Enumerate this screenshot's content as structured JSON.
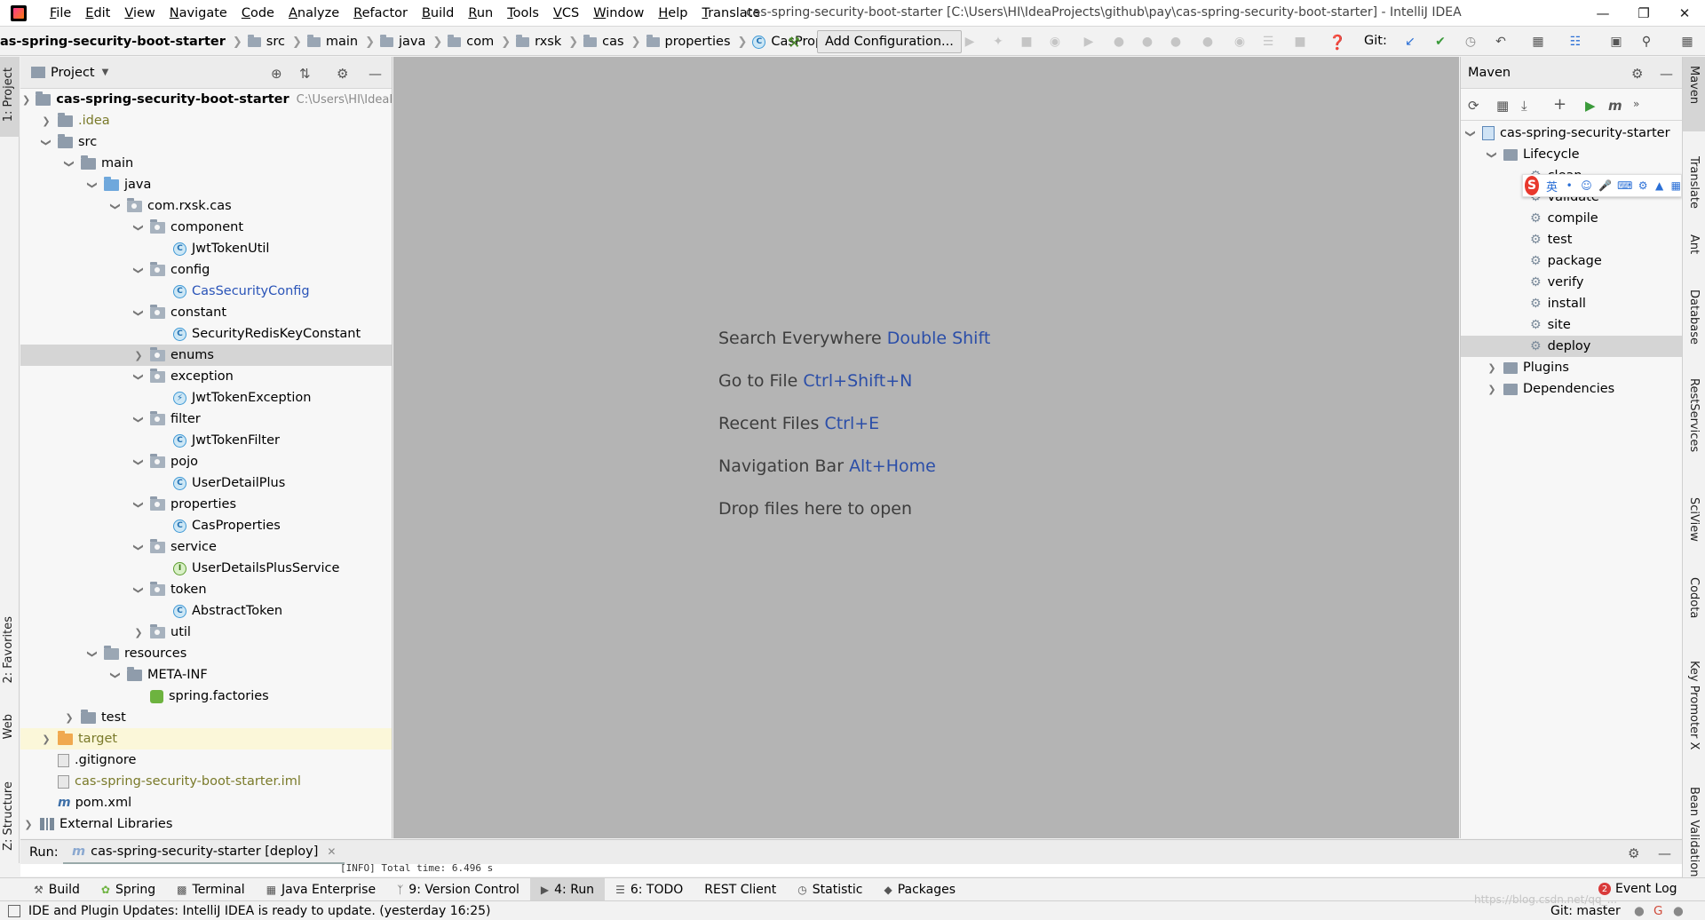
{
  "menu": [
    "File",
    "Edit",
    "View",
    "Navigate",
    "Code",
    "Analyze",
    "Refactor",
    "Build",
    "Run",
    "Tools",
    "VCS",
    "Window",
    "Help",
    "Translate"
  ],
  "window_title": "cas-spring-security-boot-starter [C:\\Users\\HI\\IdeaProjects\\github\\pay\\cas-spring-security-boot-starter] - IntelliJ IDEA",
  "breadcrumb": {
    "root": "as-spring-security-boot-starter",
    "parts": [
      "src",
      "main",
      "java",
      "com",
      "rxsk",
      "cas",
      "properties"
    ],
    "file": "CasProperties"
  },
  "toolbar": {
    "add_config": "Add Configuration...",
    "git_label": "Git:"
  },
  "left_stripe": {
    "project": "1: Project",
    "favorites": "2: Favorites",
    "web": "Web",
    "structure": "Z: Structure"
  },
  "right_stripe": [
    "Maven",
    "Translate",
    "Ant",
    "Database",
    "RestServices",
    "SciView",
    "Codota",
    "Key Promoter X",
    "Bean Validation"
  ],
  "project": {
    "title": "Project",
    "root": {
      "name": "cas-spring-security-boot-starter",
      "path": "C:\\Users\\HI\\IdeaPro"
    },
    "tree": [
      {
        "label": ".idea"
      },
      {
        "label": "src"
      },
      {
        "label": "main"
      },
      {
        "label": "java"
      },
      {
        "label": "com.rxsk.cas"
      },
      {
        "label": "component"
      },
      {
        "label": "JwtTokenUtil"
      },
      {
        "label": "config"
      },
      {
        "label": "CasSecurityConfig"
      },
      {
        "label": "constant"
      },
      {
        "label": "SecurityRedisKeyConstant"
      },
      {
        "label": "enums"
      },
      {
        "label": "exception"
      },
      {
        "label": "JwtTokenException"
      },
      {
        "label": "filter"
      },
      {
        "label": "JwtTokenFilter"
      },
      {
        "label": "pojo"
      },
      {
        "label": "UserDetailPlus"
      },
      {
        "label": "properties"
      },
      {
        "label": "CasProperties"
      },
      {
        "label": "service"
      },
      {
        "label": "UserDetailsPlusService"
      },
      {
        "label": "token"
      },
      {
        "label": "AbstractToken"
      },
      {
        "label": "util"
      },
      {
        "label": "resources"
      },
      {
        "label": "META-INF"
      },
      {
        "label": "spring.factories"
      },
      {
        "label": "test"
      },
      {
        "label": "target"
      },
      {
        "label": ".gitignore"
      },
      {
        "label": "cas-spring-security-boot-starter.iml"
      },
      {
        "label": "pom.xml"
      },
      {
        "label": "External Libraries"
      }
    ]
  },
  "editor_hints": [
    {
      "text": "Search Everywhere",
      "key": "Double Shift"
    },
    {
      "text": "Go to File",
      "key": "Ctrl+Shift+N"
    },
    {
      "text": "Recent Files",
      "key": "Ctrl+E"
    },
    {
      "text": "Navigation Bar",
      "key": "Alt+Home"
    },
    {
      "text": "Drop files here to open",
      "key": ""
    }
  ],
  "maven": {
    "title": "Maven",
    "project": "cas-spring-security-starter",
    "lifecycle": "Lifecycle",
    "phases": [
      "clean",
      "validate",
      "compile",
      "test",
      "package",
      "verify",
      "install",
      "site",
      "deploy"
    ],
    "plugins": "Plugins",
    "dependencies": "Dependencies"
  },
  "ime": {
    "lang": "英"
  },
  "run": {
    "label": "Run:",
    "tab": "cas-spring-security-starter [deploy]",
    "output": "[INFO] Total time:  6.496 s"
  },
  "tool_tabs": [
    "Build",
    "Spring",
    "Terminal",
    "Java Enterprise",
    "9: Version Control",
    "4: Run",
    "6: TODO",
    "REST Client",
    "Statistic",
    "Packages"
  ],
  "event_log": {
    "count": "2",
    "label": "Event Log"
  },
  "status": {
    "text": "IDE and Plugin Updates: IntelliJ IDEA is ready to update. (yesterday 16:25)",
    "git": "Git: master",
    "watermark": "https://blog.csdn.net/qq_... "
  }
}
